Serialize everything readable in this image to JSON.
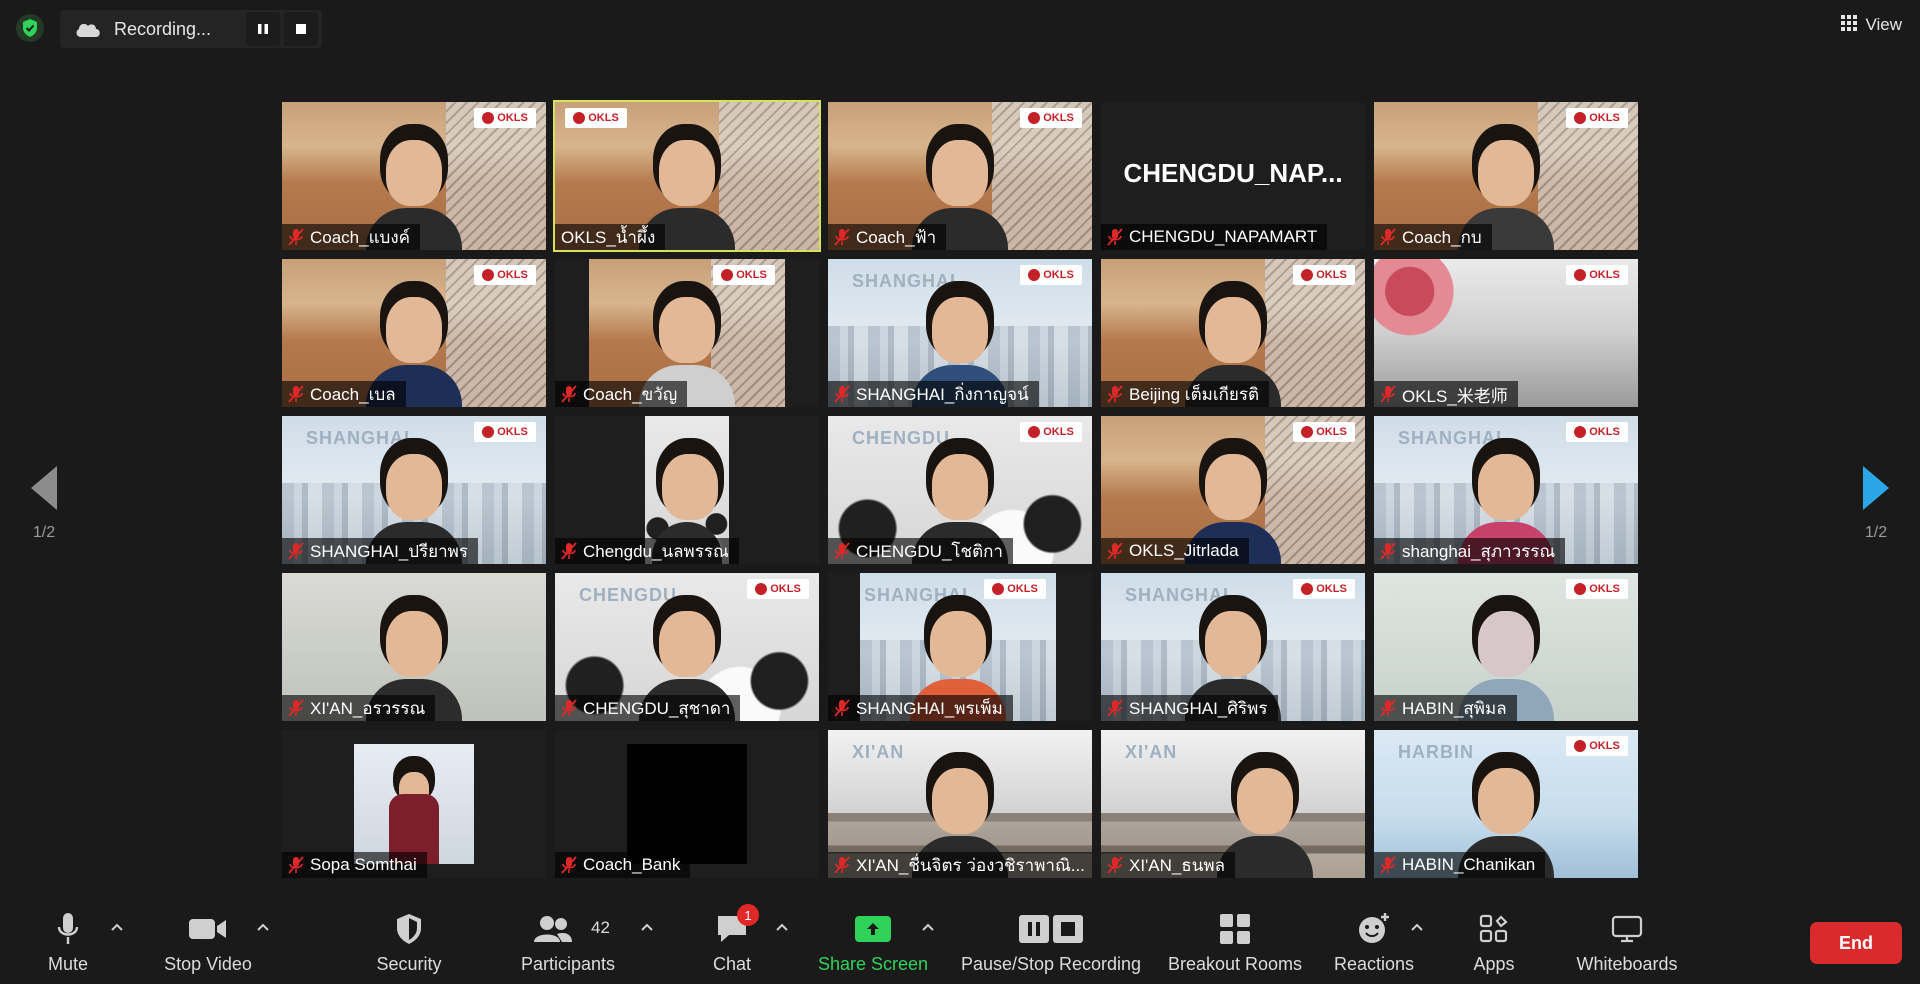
{
  "recording": {
    "label": "Recording..."
  },
  "view": {
    "label": "View"
  },
  "pager": {
    "left": "1/2",
    "right": "1/2"
  },
  "gallery": {
    "logo_text": "OKLS",
    "city_words": {
      "shanghai": "SHANGHAI",
      "chengdu": "CHENGDU",
      "xian": "XI'AN",
      "harbin": "HARBIN"
    },
    "tiles": [
      {
        "name": "Coach_แบงค์",
        "muted": true
      },
      {
        "name": "OKLS_น้ำผึ้ง",
        "muted": false,
        "active": true
      },
      {
        "name": "Coach_ฟ้า",
        "muted": true
      },
      {
        "name": "CHENGDU_NAPAMART",
        "muted": true,
        "display_name": "CHENGDU_NAP..."
      },
      {
        "name": "Coach_กบ",
        "muted": true
      },
      {
        "name": "Coach_เบล",
        "muted": true
      },
      {
        "name": "Coach_ขวัญ",
        "muted": true
      },
      {
        "name": "SHANGHAI_กิ่งกาญจน์",
        "muted": true
      },
      {
        "name": "Beijing เต็มเกียรติ",
        "muted": true
      },
      {
        "name": "OKLS_米老师",
        "muted": true
      },
      {
        "name": "SHANGHAI_ปรียาพร",
        "muted": true
      },
      {
        "name": "Chengdu_นลพรรณ",
        "muted": true
      },
      {
        "name": "CHENGDU_โชติกา",
        "muted": true
      },
      {
        "name": "OKLS_Jitrlada",
        "muted": true
      },
      {
        "name": "shanghai_สุภาวรรณ",
        "muted": true
      },
      {
        "name": "XI'AN_อรวรรณ",
        "muted": true
      },
      {
        "name": "CHENGDU_สุชาดา",
        "muted": true
      },
      {
        "name": "SHANGHAI_พรเพ็ม",
        "muted": true
      },
      {
        "name": "SHANGHAI_ศิริพร",
        "muted": true
      },
      {
        "name": "HABIN_สุพิมล",
        "muted": true
      },
      {
        "name": "Sopa Somthai",
        "muted": true
      },
      {
        "name": "Coach_Bank",
        "muted": true
      },
      {
        "name": "XI'AN_ชื่นจิตร ว่องวชิราพาณิ...",
        "muted": true
      },
      {
        "name": "XI'AN_ธนพล",
        "muted": true
      },
      {
        "name": "HABIN_Chanikan",
        "muted": true
      }
    ]
  },
  "toolbar": {
    "mute": "Mute",
    "stop_video": "Stop Video",
    "security": "Security",
    "participants": "Participants",
    "participants_count": "42",
    "chat": "Chat",
    "chat_badge": "1",
    "share_screen": "Share Screen",
    "pause_stop_recording": "Pause/Stop Recording",
    "breakout_rooms": "Breakout Rooms",
    "reactions": "Reactions",
    "apps": "Apps",
    "whiteboards": "Whiteboards",
    "end": "End"
  },
  "colors": {
    "accent_green": "#2fd35a",
    "end_red": "#d92b2b",
    "active_speaker": "#d6e35a",
    "pager_blue": "#2aa5e8"
  }
}
